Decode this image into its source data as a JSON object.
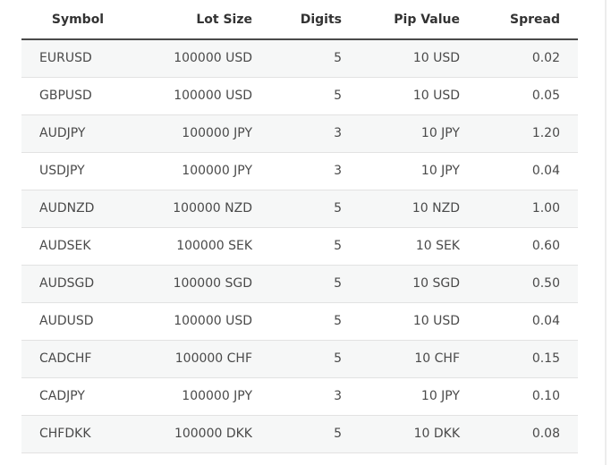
{
  "table": {
    "headers": {
      "symbol": "Symbol",
      "lot_size": "Lot Size",
      "digits": "Digits",
      "pip_value": "Pip Value",
      "spread": "Spread"
    },
    "rows": [
      {
        "symbol": "EURUSD",
        "lot_size": "100000 USD",
        "digits": "5",
        "pip_value": "10 USD",
        "spread": "0.02"
      },
      {
        "symbol": "GBPUSD",
        "lot_size": "100000 USD",
        "digits": "5",
        "pip_value": "10 USD",
        "spread": "0.05"
      },
      {
        "symbol": "AUDJPY",
        "lot_size": "100000 JPY",
        "digits": "3",
        "pip_value": "10 JPY",
        "spread": "1.20"
      },
      {
        "symbol": "USDJPY",
        "lot_size": "100000 JPY",
        "digits": "3",
        "pip_value": "10 JPY",
        "spread": "0.04"
      },
      {
        "symbol": "AUDNZD",
        "lot_size": "100000 NZD",
        "digits": "5",
        "pip_value": "10 NZD",
        "spread": "1.00"
      },
      {
        "symbol": "AUDSEK",
        "lot_size": "100000 SEK",
        "digits": "5",
        "pip_value": "10 SEK",
        "spread": "0.60"
      },
      {
        "symbol": "AUDSGD",
        "lot_size": "100000 SGD",
        "digits": "5",
        "pip_value": "10 SGD",
        "spread": "0.50"
      },
      {
        "symbol": "AUDUSD",
        "lot_size": "100000 USD",
        "digits": "5",
        "pip_value": "10 USD",
        "spread": "0.04"
      },
      {
        "symbol": "CADCHF",
        "lot_size": "100000 CHF",
        "digits": "5",
        "pip_value": "10 CHF",
        "spread": "0.15"
      },
      {
        "symbol": "CADJPY",
        "lot_size": "100000 JPY",
        "digits": "3",
        "pip_value": "10 JPY",
        "spread": "0.10"
      },
      {
        "symbol": "CHFDKK",
        "lot_size": "100000 DKK",
        "digits": "5",
        "pip_value": "10 DKK",
        "spread": "0.08"
      }
    ]
  }
}
